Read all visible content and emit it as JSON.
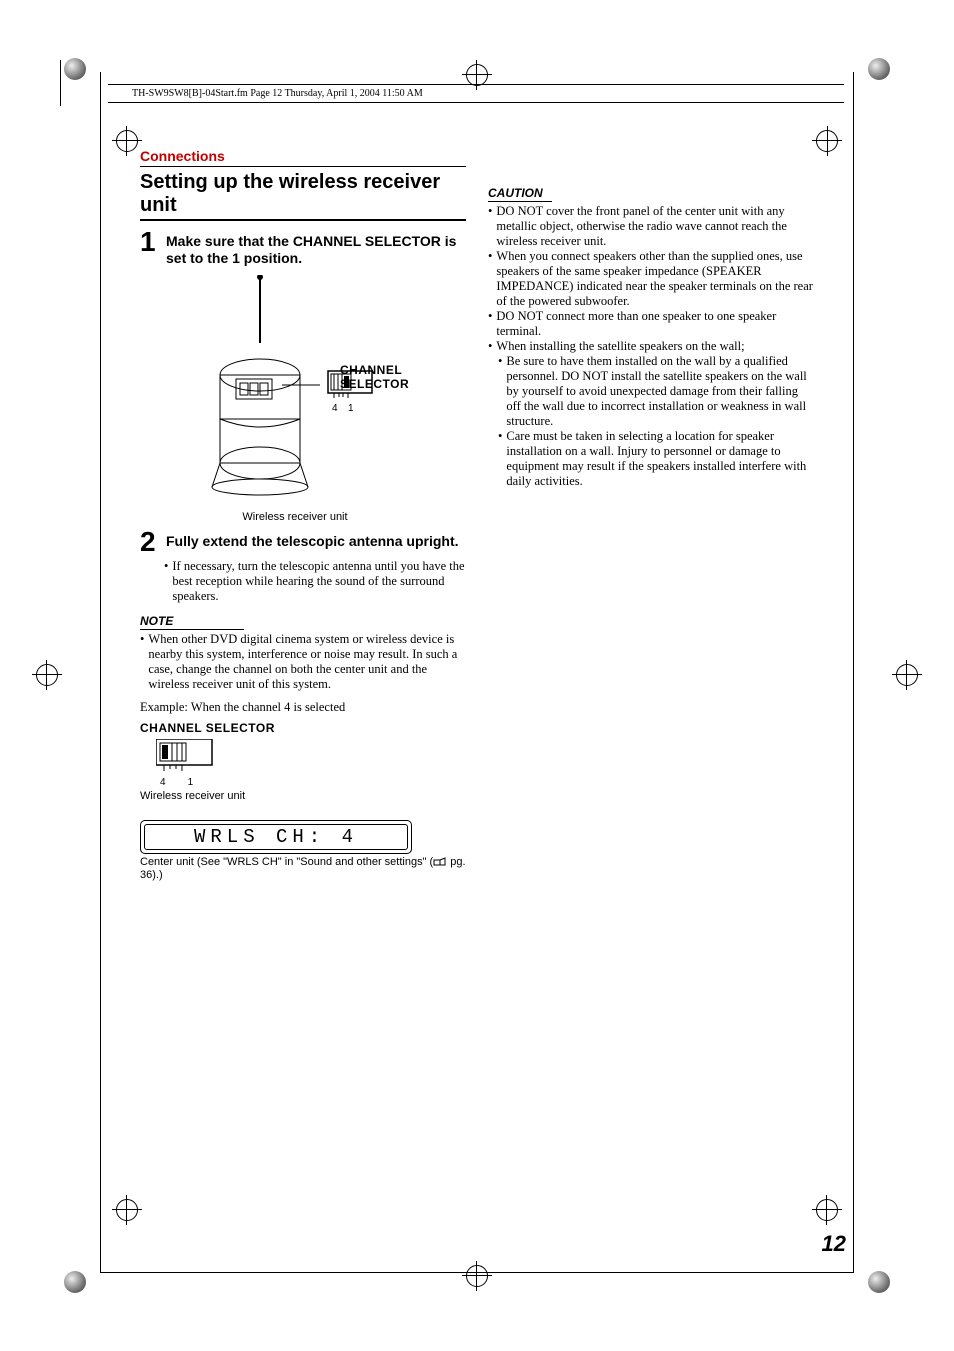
{
  "header": {
    "text": "TH-SW9SW8[B]-04Start.fm  Page 12  Thursday, April 1, 2004  11:50 AM"
  },
  "section_label": "Connections",
  "main_heading": "Setting up the wireless receiver unit",
  "steps": [
    {
      "num": "1",
      "text": "Make sure that the CHANNEL SELECTOR is set to the 1 position."
    },
    {
      "num": "2",
      "text": "Fully extend the telescopic antenna upright.",
      "bullet": "If necessary, turn the telescopic antenna until you have the best reception while hearing the sound of the surround speakers."
    }
  ],
  "fig1": {
    "callout": "CHANNEL SELECTOR",
    "tick_left": "4",
    "tick_right": "1",
    "caption": "Wireless receiver unit"
  },
  "note": {
    "head": "NOTE",
    "item": "When other DVD digital cinema system or wireless device is nearby this system, interference or noise may result. In such a case, change the channel on both the center unit and the wireless receiver unit of this system."
  },
  "example": {
    "line": "Example: When the channel 4 is selected",
    "selector_label": "CHANNEL SELECTOR",
    "tick_left": "4",
    "tick_right": "1",
    "sub_caption": "Wireless receiver unit",
    "lcd_text": "WRLS CH: 4",
    "lcd_sub_a": "Center unit (See \"WRLS CH\" in \"Sound and other settings\" (",
    "lcd_sub_b": " pg. 36).)"
  },
  "caution": {
    "head": "CAUTION",
    "items": [
      "DO NOT cover the front panel of the center unit with any metallic object, otherwise the radio wave cannot reach the wireless receiver unit.",
      "When you connect speakers other than the supplied ones, use speakers of the same speaker impedance (SPEAKER IMPEDANCE) indicated near the speaker terminals on the rear of the powered subwoofer.",
      "DO NOT connect more than one speaker to one speaker terminal.",
      "When installing the satellite speakers on the wall;"
    ],
    "sub_items": [
      "Be sure to have them installed on the wall by a qualified personnel. DO NOT install the satellite speakers on the wall by yourself to avoid unexpected damage from their falling off the wall due to incorrect installation or weakness in wall structure.",
      "Care must be taken in selecting a location for speaker installation on a wall. Injury to personnel or damage to equipment may result if the speakers installed interfere with daily activities."
    ]
  },
  "page_number": "12"
}
